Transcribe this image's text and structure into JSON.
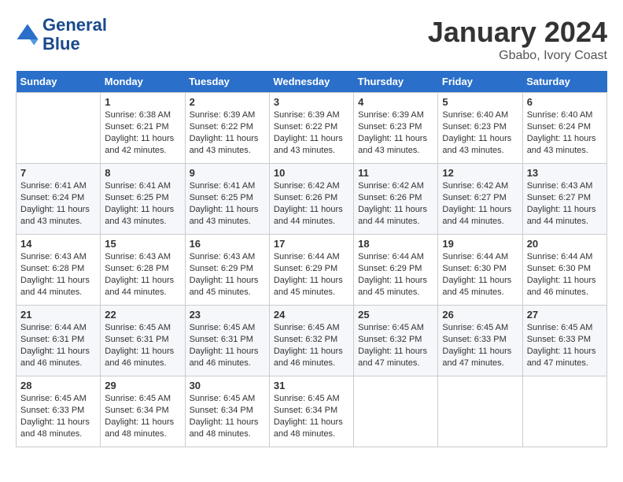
{
  "header": {
    "logo_line1": "General",
    "logo_line2": "Blue",
    "month_title": "January 2024",
    "location": "Gbabo, Ivory Coast"
  },
  "weekdays": [
    "Sunday",
    "Monday",
    "Tuesday",
    "Wednesday",
    "Thursday",
    "Friday",
    "Saturday"
  ],
  "weeks": [
    [
      {
        "day": "",
        "sunrise": "",
        "sunset": "",
        "daylight": ""
      },
      {
        "day": "1",
        "sunrise": "Sunrise: 6:38 AM",
        "sunset": "Sunset: 6:21 PM",
        "daylight": "Daylight: 11 hours and 42 minutes."
      },
      {
        "day": "2",
        "sunrise": "Sunrise: 6:39 AM",
        "sunset": "Sunset: 6:22 PM",
        "daylight": "Daylight: 11 hours and 43 minutes."
      },
      {
        "day": "3",
        "sunrise": "Sunrise: 6:39 AM",
        "sunset": "Sunset: 6:22 PM",
        "daylight": "Daylight: 11 hours and 43 minutes."
      },
      {
        "day": "4",
        "sunrise": "Sunrise: 6:39 AM",
        "sunset": "Sunset: 6:23 PM",
        "daylight": "Daylight: 11 hours and 43 minutes."
      },
      {
        "day": "5",
        "sunrise": "Sunrise: 6:40 AM",
        "sunset": "Sunset: 6:23 PM",
        "daylight": "Daylight: 11 hours and 43 minutes."
      },
      {
        "day": "6",
        "sunrise": "Sunrise: 6:40 AM",
        "sunset": "Sunset: 6:24 PM",
        "daylight": "Daylight: 11 hours and 43 minutes."
      }
    ],
    [
      {
        "day": "7",
        "sunrise": "Sunrise: 6:41 AM",
        "sunset": "Sunset: 6:24 PM",
        "daylight": "Daylight: 11 hours and 43 minutes."
      },
      {
        "day": "8",
        "sunrise": "Sunrise: 6:41 AM",
        "sunset": "Sunset: 6:25 PM",
        "daylight": "Daylight: 11 hours and 43 minutes."
      },
      {
        "day": "9",
        "sunrise": "Sunrise: 6:41 AM",
        "sunset": "Sunset: 6:25 PM",
        "daylight": "Daylight: 11 hours and 43 minutes."
      },
      {
        "day": "10",
        "sunrise": "Sunrise: 6:42 AM",
        "sunset": "Sunset: 6:26 PM",
        "daylight": "Daylight: 11 hours and 44 minutes."
      },
      {
        "day": "11",
        "sunrise": "Sunrise: 6:42 AM",
        "sunset": "Sunset: 6:26 PM",
        "daylight": "Daylight: 11 hours and 44 minutes."
      },
      {
        "day": "12",
        "sunrise": "Sunrise: 6:42 AM",
        "sunset": "Sunset: 6:27 PM",
        "daylight": "Daylight: 11 hours and 44 minutes."
      },
      {
        "day": "13",
        "sunrise": "Sunrise: 6:43 AM",
        "sunset": "Sunset: 6:27 PM",
        "daylight": "Daylight: 11 hours and 44 minutes."
      }
    ],
    [
      {
        "day": "14",
        "sunrise": "Sunrise: 6:43 AM",
        "sunset": "Sunset: 6:28 PM",
        "daylight": "Daylight: 11 hours and 44 minutes."
      },
      {
        "day": "15",
        "sunrise": "Sunrise: 6:43 AM",
        "sunset": "Sunset: 6:28 PM",
        "daylight": "Daylight: 11 hours and 44 minutes."
      },
      {
        "day": "16",
        "sunrise": "Sunrise: 6:43 AM",
        "sunset": "Sunset: 6:29 PM",
        "daylight": "Daylight: 11 hours and 45 minutes."
      },
      {
        "day": "17",
        "sunrise": "Sunrise: 6:44 AM",
        "sunset": "Sunset: 6:29 PM",
        "daylight": "Daylight: 11 hours and 45 minutes."
      },
      {
        "day": "18",
        "sunrise": "Sunrise: 6:44 AM",
        "sunset": "Sunset: 6:29 PM",
        "daylight": "Daylight: 11 hours and 45 minutes."
      },
      {
        "day": "19",
        "sunrise": "Sunrise: 6:44 AM",
        "sunset": "Sunset: 6:30 PM",
        "daylight": "Daylight: 11 hours and 45 minutes."
      },
      {
        "day": "20",
        "sunrise": "Sunrise: 6:44 AM",
        "sunset": "Sunset: 6:30 PM",
        "daylight": "Daylight: 11 hours and 46 minutes."
      }
    ],
    [
      {
        "day": "21",
        "sunrise": "Sunrise: 6:44 AM",
        "sunset": "Sunset: 6:31 PM",
        "daylight": "Daylight: 11 hours and 46 minutes."
      },
      {
        "day": "22",
        "sunrise": "Sunrise: 6:45 AM",
        "sunset": "Sunset: 6:31 PM",
        "daylight": "Daylight: 11 hours and 46 minutes."
      },
      {
        "day": "23",
        "sunrise": "Sunrise: 6:45 AM",
        "sunset": "Sunset: 6:31 PM",
        "daylight": "Daylight: 11 hours and 46 minutes."
      },
      {
        "day": "24",
        "sunrise": "Sunrise: 6:45 AM",
        "sunset": "Sunset: 6:32 PM",
        "daylight": "Daylight: 11 hours and 46 minutes."
      },
      {
        "day": "25",
        "sunrise": "Sunrise: 6:45 AM",
        "sunset": "Sunset: 6:32 PM",
        "daylight": "Daylight: 11 hours and 47 minutes."
      },
      {
        "day": "26",
        "sunrise": "Sunrise: 6:45 AM",
        "sunset": "Sunset: 6:33 PM",
        "daylight": "Daylight: 11 hours and 47 minutes."
      },
      {
        "day": "27",
        "sunrise": "Sunrise: 6:45 AM",
        "sunset": "Sunset: 6:33 PM",
        "daylight": "Daylight: 11 hours and 47 minutes."
      }
    ],
    [
      {
        "day": "28",
        "sunrise": "Sunrise: 6:45 AM",
        "sunset": "Sunset: 6:33 PM",
        "daylight": "Daylight: 11 hours and 48 minutes."
      },
      {
        "day": "29",
        "sunrise": "Sunrise: 6:45 AM",
        "sunset": "Sunset: 6:34 PM",
        "daylight": "Daylight: 11 hours and 48 minutes."
      },
      {
        "day": "30",
        "sunrise": "Sunrise: 6:45 AM",
        "sunset": "Sunset: 6:34 PM",
        "daylight": "Daylight: 11 hours and 48 minutes."
      },
      {
        "day": "31",
        "sunrise": "Sunrise: 6:45 AM",
        "sunset": "Sunset: 6:34 PM",
        "daylight": "Daylight: 11 hours and 48 minutes."
      },
      {
        "day": "",
        "sunrise": "",
        "sunset": "",
        "daylight": ""
      },
      {
        "day": "",
        "sunrise": "",
        "sunset": "",
        "daylight": ""
      },
      {
        "day": "",
        "sunrise": "",
        "sunset": "",
        "daylight": ""
      }
    ]
  ]
}
